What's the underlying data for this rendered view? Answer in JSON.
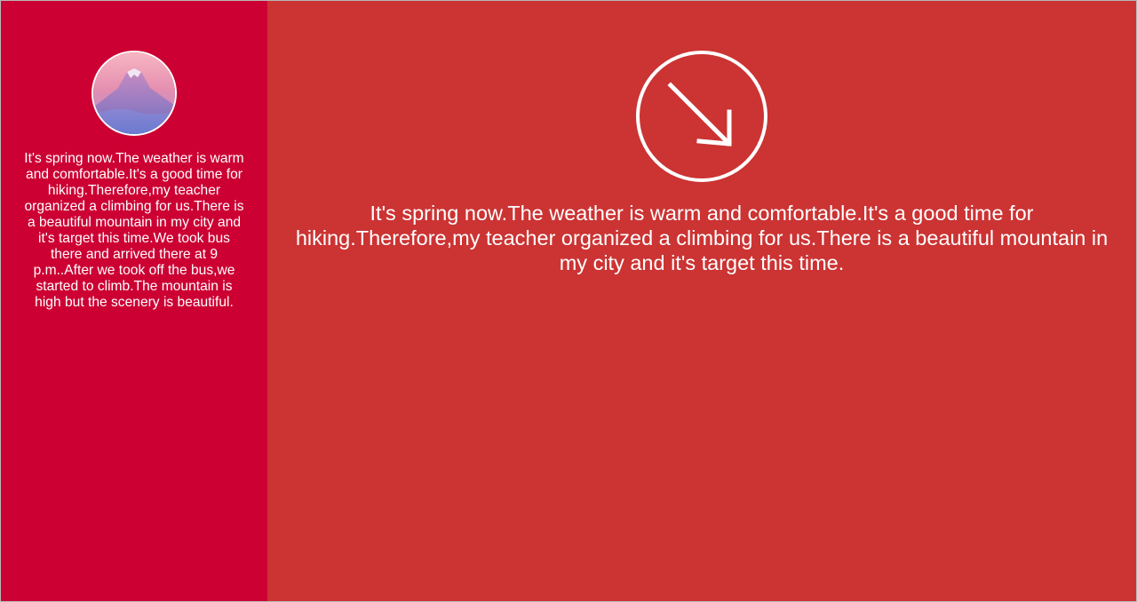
{
  "colors": {
    "sidebar_bg": "#cc0033",
    "main_bg": "#cc3333",
    "text": "#ffffff"
  },
  "sidebar": {
    "avatar_icon": "mountain-photo",
    "text": "It's spring now.The weather is warm and comfortable.It's a good time for hiking.Therefore,my teacher organized a climbing for us.There is a beautiful mountain in my city and it's target this time.We took bus there and arrived there at 9 p.m..After we took off the bus,we started to climb.The mountain is high but the scenery is beautiful."
  },
  "main": {
    "arrow_icon": "arrow-down-right-circle-icon",
    "text": "It's spring now.The weather is warm and comfortable.It's a good time for hiking.Therefore,my teacher organized a climbing for us.There is a beautiful mountain in my city and it's target this time."
  }
}
